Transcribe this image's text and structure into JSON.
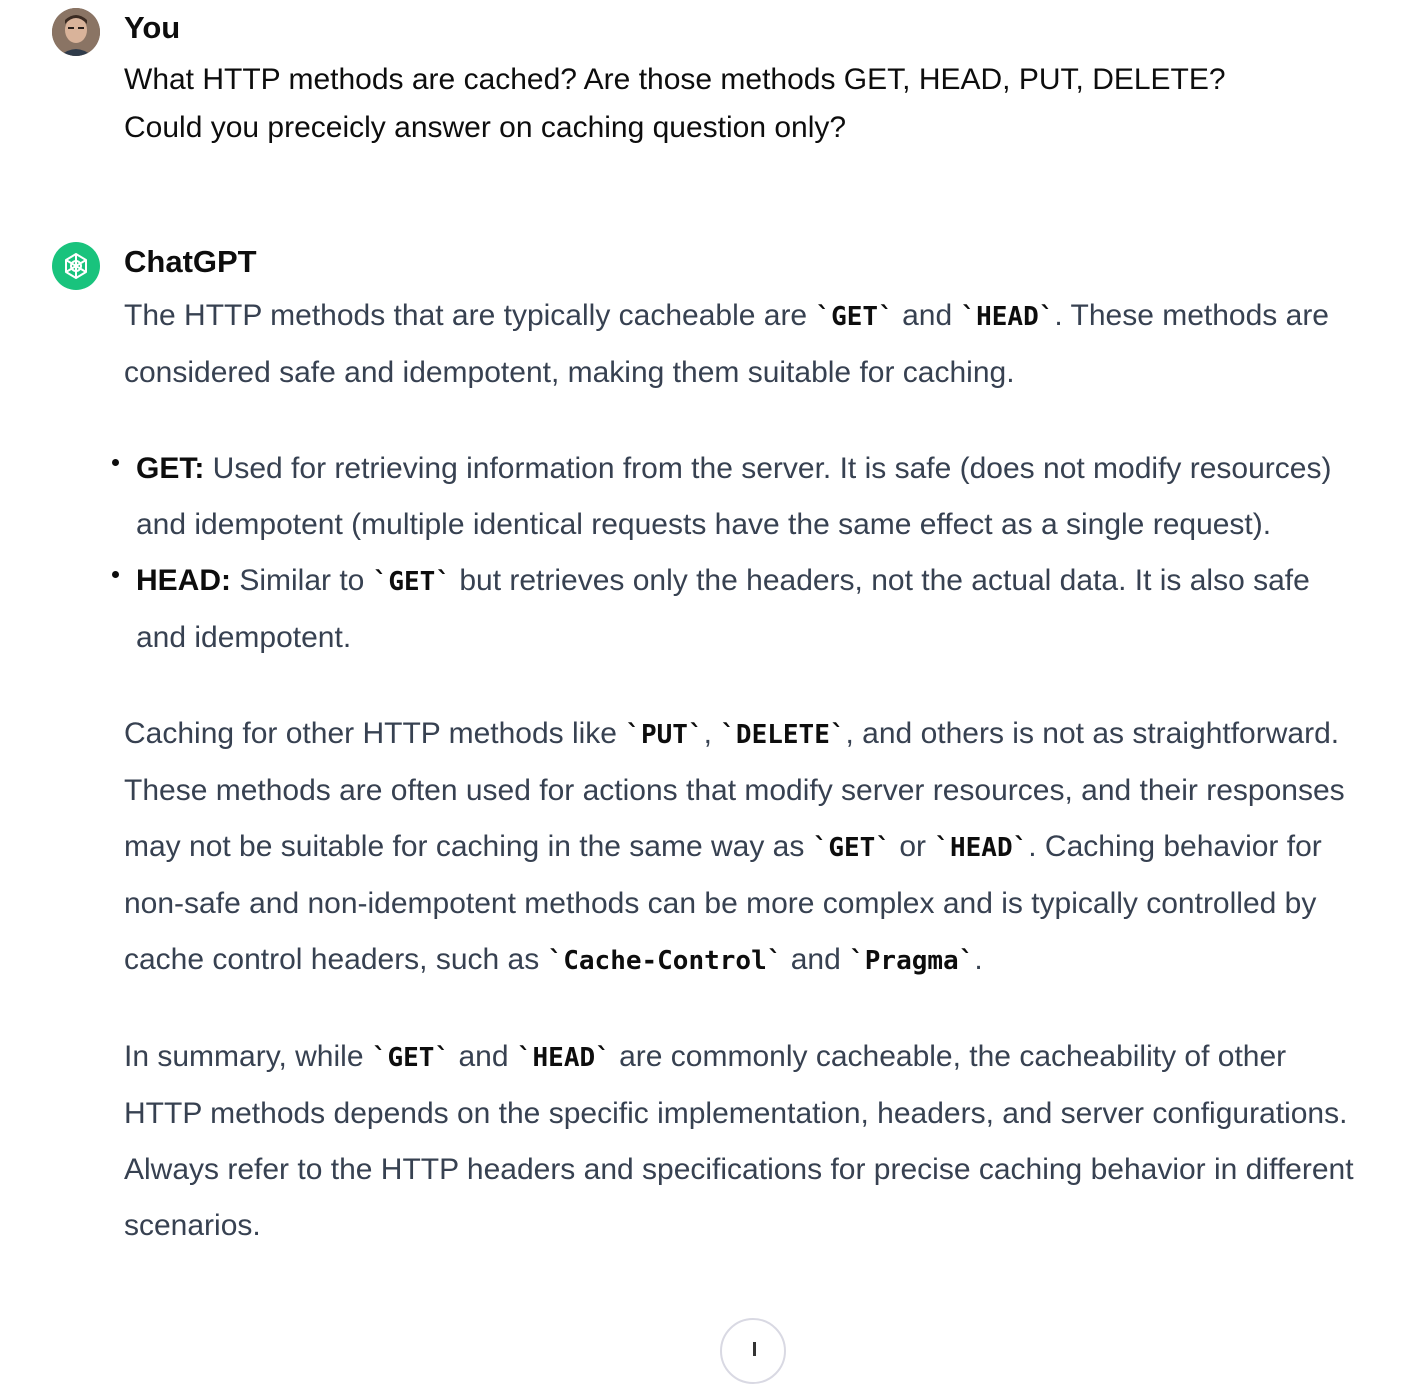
{
  "user_turn": {
    "author": "You",
    "message_line1": "What HTTP methods are cached? Are those methods GET, HEAD, PUT, DELETE?",
    "message_line2": "Could you preceicly answer on caching question only?"
  },
  "assistant_turn": {
    "author": "ChatGPT",
    "p1": {
      "t1": "The HTTP methods that are typically cacheable are ",
      "c1": "`GET`",
      "t2": " and ",
      "c2": "`HEAD`",
      "t3": ". These methods are considered safe and idempotent, making them suitable for caching."
    },
    "bullets": {
      "get": {
        "label": "GET:",
        "text": " Used for retrieving information from the server. It is safe (does not modify resources) and idempotent (multiple identical requests have the same effect as a single request)."
      },
      "head": {
        "label": "HEAD:",
        "t1": " Similar to ",
        "c1": "`GET`",
        "t2": " but retrieves only the headers, not the actual data. It is also safe and idempotent."
      }
    },
    "p2": {
      "t1": "Caching for other HTTP methods like ",
      "c1": "`PUT`",
      "t2": ", ",
      "c2": "`DELETE`",
      "t3": ", and others is not as straightforward. These methods are often used for actions that modify server resources, and their responses may not be suitable for caching in the same way as ",
      "c3": "`GET`",
      "t4": " or ",
      "c4": "`HEAD`",
      "t5": ". Caching behavior for non-safe and non-idempotent methods can be more complex and is typically controlled by cache control headers, such as ",
      "c5": "`Cache-Control`",
      "t6": " and ",
      "c6": "`Pragma`",
      "t7": "."
    },
    "p3": {
      "t1": "In summary, while ",
      "c1": "`GET`",
      "t2": " and ",
      "c2": "`HEAD`",
      "t3": " are commonly cacheable, the cacheability of other HTTP methods depends on the specific implementation, headers, and server configurations. Always refer to the HTTP headers and specifications for precise caching behavior in different scenarios."
    }
  },
  "icons": {
    "user_avatar": "user-avatar-photo",
    "assistant_avatar": "openai-logo-icon",
    "scroll": "arrow-down-icon"
  },
  "colors": {
    "gpt_avatar_bg": "#19c37d",
    "answer_text": "#374151",
    "heading_text": "#0d0d0d"
  }
}
